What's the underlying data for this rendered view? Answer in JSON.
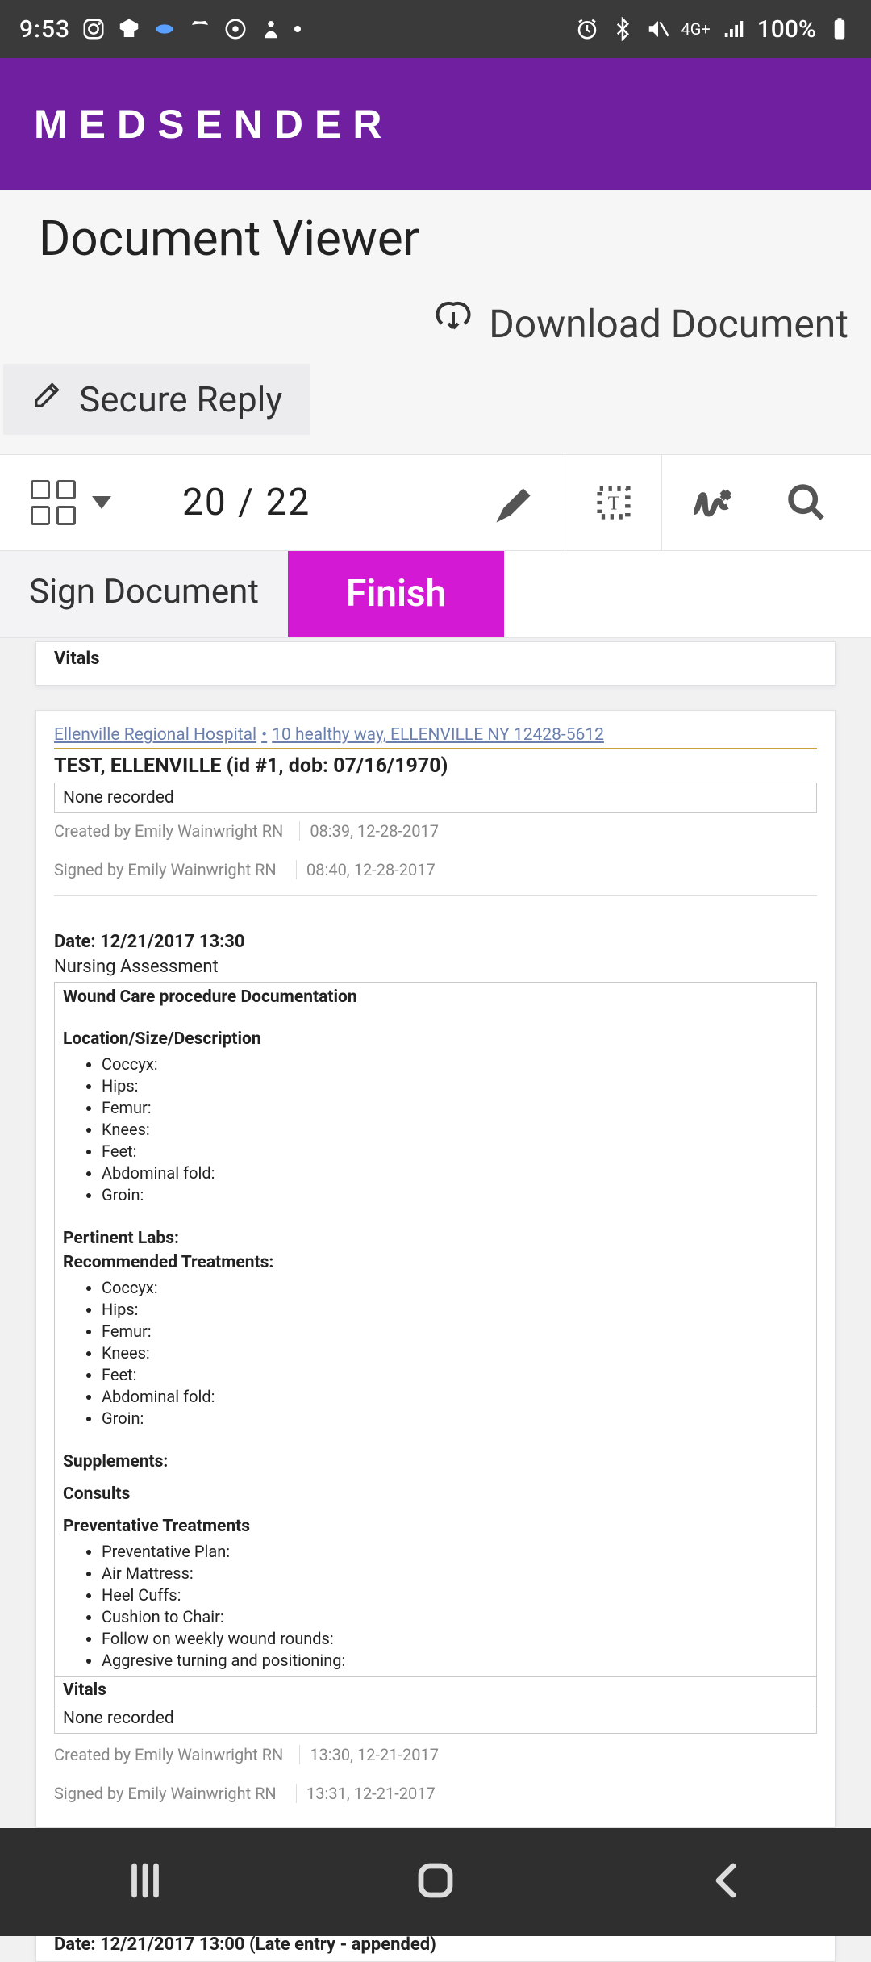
{
  "status": {
    "time": "9:53",
    "network_label": "4G+",
    "battery": "100%"
  },
  "header": {
    "brand": "MEDSENDER"
  },
  "toolbar": {
    "title": "Document Viewer",
    "download": "Download Document",
    "secure_reply": "Secure Reply",
    "page_indicator": "20 / 22",
    "sign_document": "Sign Document",
    "finish": "Finish"
  },
  "doc": {
    "peek_top_vitals": "Vitals",
    "hospital_line": {
      "name": "Ellenville Regional Hospital",
      "address": "10 healthy way, ELLENVILLE NY 12428-5612"
    },
    "patient_title": "TEST, ELLENVILLE (id #1, dob: 07/16/1970)",
    "none_recorded": "None recorded",
    "meta1": {
      "created_by": "Created by Emily Wainwright RN",
      "created_at": "08:39, 12-28-2017",
      "signed_by": "Signed by Emily Wainwright RN",
      "signed_at": "08:40, 12-28-2017"
    },
    "date_header": "Date: 12/21/2017 13:30",
    "section_title": "Nursing Assessment",
    "panel": {
      "title": "Wound Care procedure Documentation",
      "loc_header": "Location/Size/Description",
      "loc_items": [
        "Coccyx:",
        "Hips:",
        "Femur:",
        "Knees:",
        "Feet:",
        "Abdominal fold:",
        "Groin:"
      ],
      "pertinent_labs": "Pertinent Labs:",
      "rec_treatments": "Recommended Treatments:",
      "rec_items": [
        "Coccyx:",
        "Hips:",
        "Femur:",
        "Knees:",
        "Feet:",
        "Abdominal fold:",
        "Groin:"
      ],
      "supplements": "Supplements:",
      "consults": "Consults",
      "preventative": "Preventative Treatments",
      "prev_items": [
        "Preventative Plan:",
        "Air Mattress:",
        "Heel Cuffs:",
        "Cushion to Chair:",
        "Follow on weekly wound rounds:",
        "Aggresive turning and positioning:"
      ]
    },
    "vitals_label": "Vitals",
    "meta2": {
      "created_by": "Created by Emily Wainwright RN",
      "created_at": "13:30, 12-21-2017",
      "signed_by": "Signed by Emily Wainwright RN",
      "signed_at": "13:31, 12-21-2017"
    },
    "peek_bottom": {
      "date_header": "Date: 12/21/2017 13:00 (Late entry - appended)"
    }
  }
}
